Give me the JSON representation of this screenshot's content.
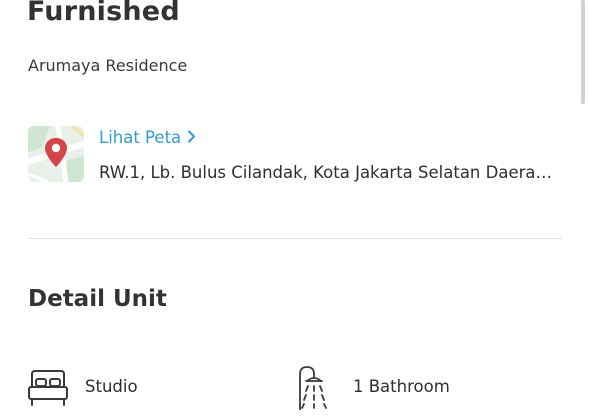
{
  "listing": {
    "title": "Furnished",
    "property_name": "Arumaya Residence"
  },
  "location": {
    "map_link_label": "Lihat Peta",
    "address": "RW.1, Lb. Bulus Cilandak, Kota Jakarta Selatan Daera…",
    "map_icon": "map-pin-icon",
    "link_icon": "chevron-right-icon"
  },
  "detail_unit": {
    "section_title": "Detail Unit",
    "features": [
      {
        "icon": "bed-icon",
        "label": "Studio"
      },
      {
        "icon": "shower-icon",
        "label": "1 Bathroom"
      }
    ]
  },
  "colors": {
    "link": "#2a9ed6",
    "pin": "#d64545",
    "divider": "#e0e0e0"
  }
}
